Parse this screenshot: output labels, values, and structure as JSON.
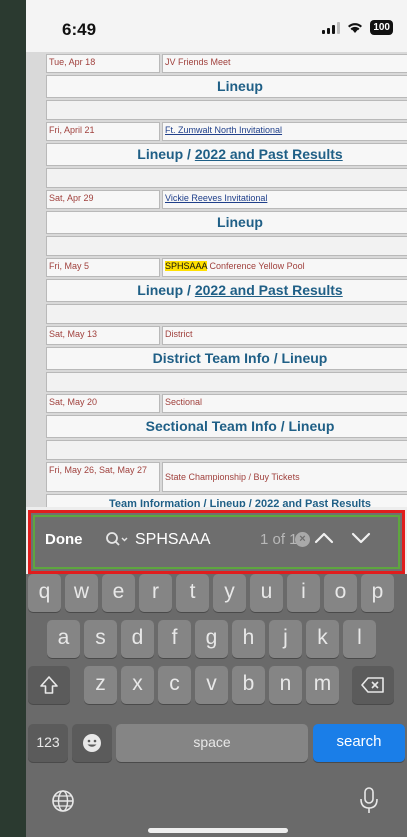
{
  "status": {
    "time": "6:49",
    "battery": "100"
  },
  "schedule": {
    "rows": [
      {
        "date": "Tue, Apr 18",
        "event": "JV Friends Meet",
        "big": [
          "Lineup"
        ]
      },
      {
        "date": "Fri, April 21",
        "event": "Ft. Zumwalt North Invitational",
        "event_link": true,
        "big": [
          "Lineup / ",
          "2022 and Past Results"
        ]
      },
      {
        "date": "Sat, Apr 29",
        "event": "Vickie Reeves Invitational",
        "event_link": true,
        "big": [
          "Lineup"
        ]
      },
      {
        "date": "Fri, May 5",
        "event_highlight": "SPHSAAA",
        "event": " Conference Yellow Pool",
        "big": [
          "Lineup / ",
          "2022 and Past Results"
        ]
      },
      {
        "date": "Sat, May 13",
        "event": "District",
        "big": [
          "District Team Info / Lineup"
        ]
      },
      {
        "date": "Sat, May 20",
        "event": "Sectional",
        "big": [
          "Sectional Team Info / Lineup"
        ]
      },
      {
        "date": "Fri, May 26, Sat, May 27",
        "event": "State Championship / Buy Tickets",
        "big_small": [
          "Team Information / Lineup / ",
          "2022 and Past Results"
        ]
      }
    ]
  },
  "find_bar": {
    "done_label": "Done",
    "query": "SPHSAAA",
    "match_count": "1 of 1",
    "icons": [
      "search-icon",
      "clear-icon",
      "chevron-up-icon",
      "chevron-down-icon"
    ]
  },
  "keyboard": {
    "row1": [
      "q",
      "w",
      "e",
      "r",
      "t",
      "y",
      "u",
      "i",
      "o",
      "p"
    ],
    "row2": [
      "a",
      "s",
      "d",
      "f",
      "g",
      "h",
      "j",
      "k",
      "l"
    ],
    "row3": [
      "z",
      "x",
      "c",
      "v",
      "b",
      "n",
      "m"
    ],
    "numbers_label": "123",
    "space_label": "space",
    "search_label": "search"
  },
  "colors": {
    "highlight": "#ffe000",
    "link": "#1f5f86",
    "date_text": "#a0413d",
    "find_border": "#e01d1d",
    "search_key": "#1a7ee8"
  }
}
